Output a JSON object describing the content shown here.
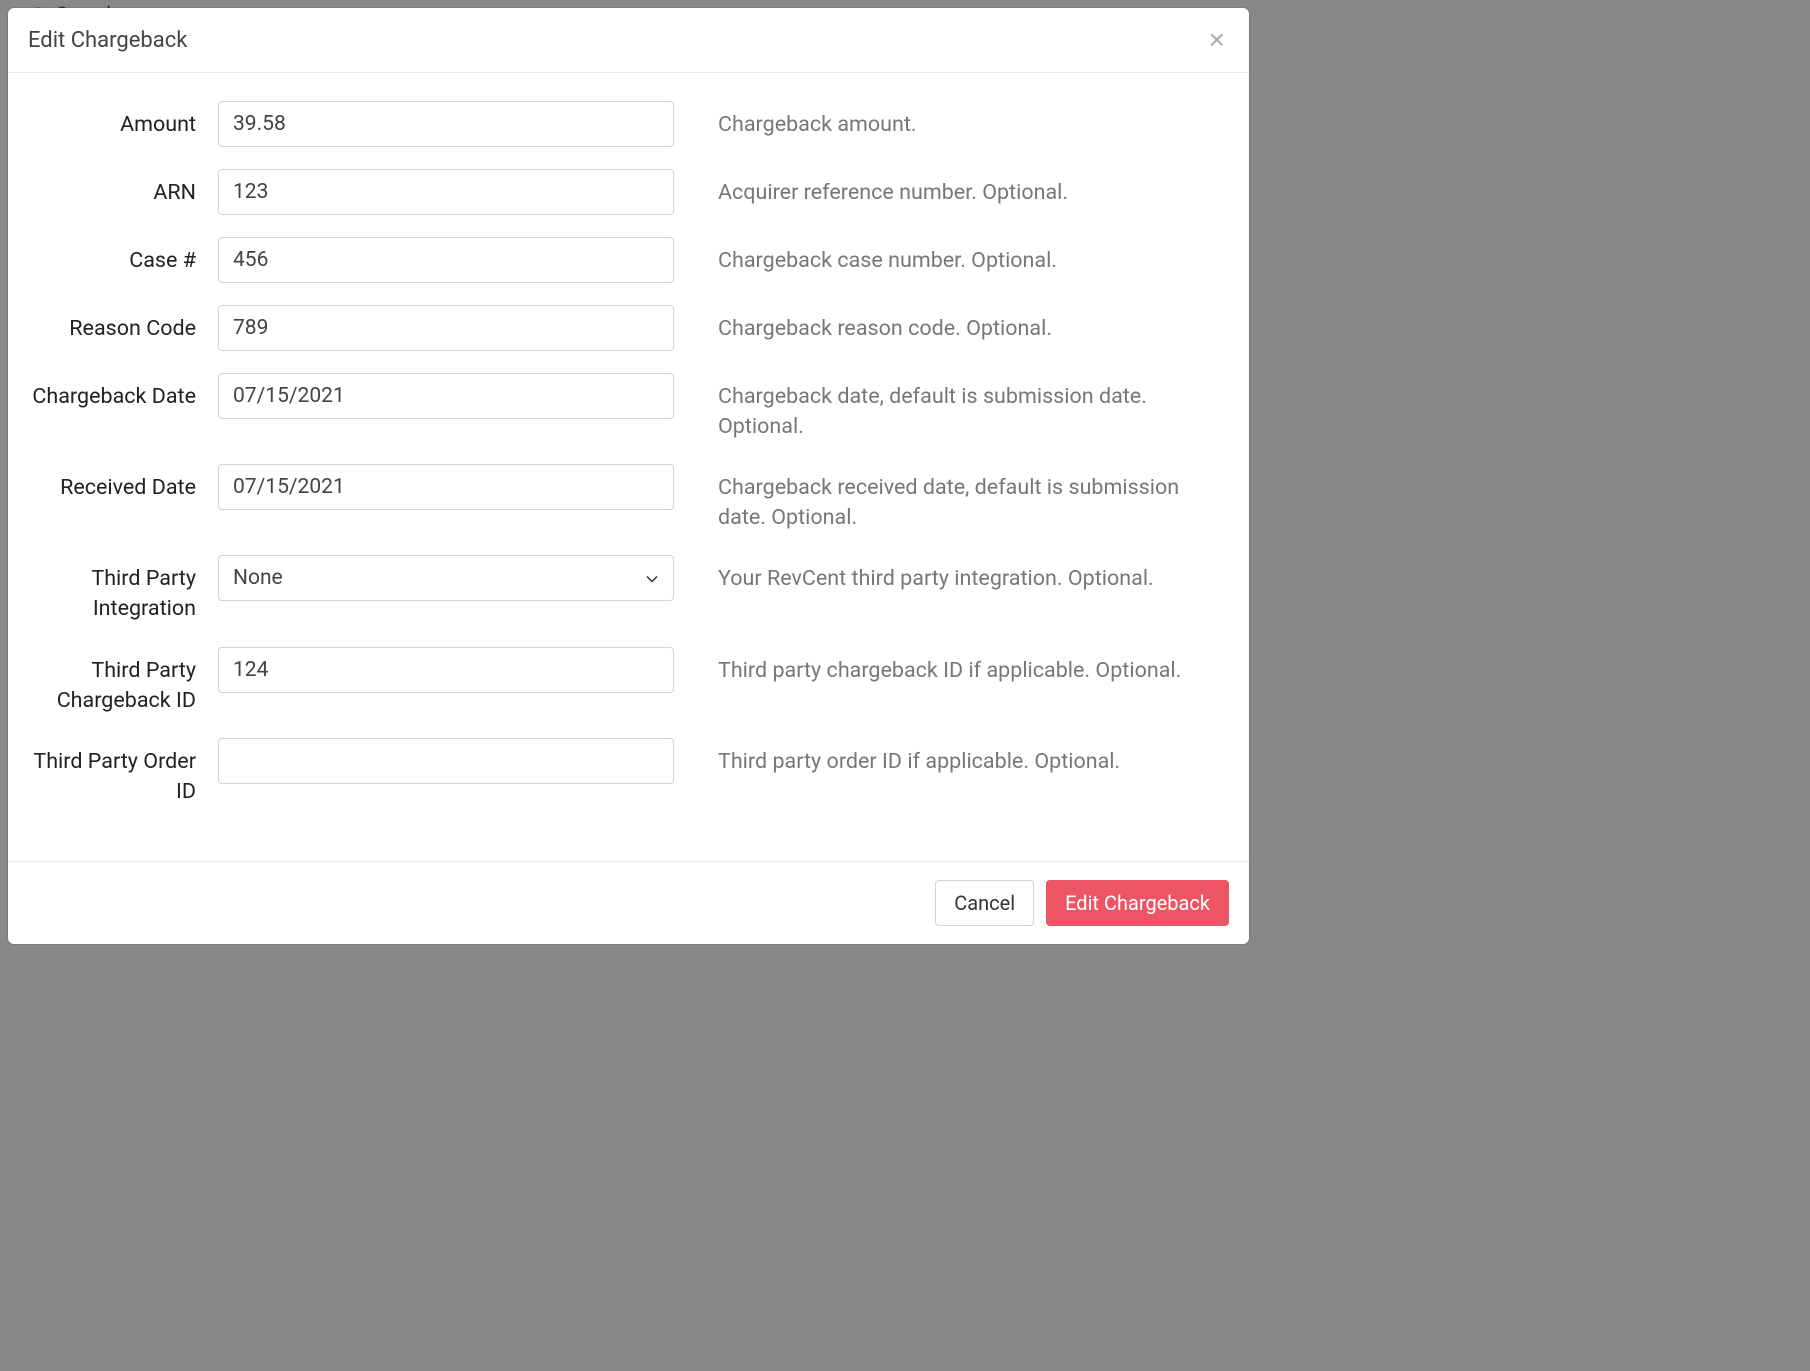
{
  "backdrop": {
    "search_hint": "Search"
  },
  "modal": {
    "title": "Edit Chargeback",
    "close_label": "×"
  },
  "form": {
    "amount": {
      "label": "Amount",
      "value": "39.58",
      "help": "Chargeback amount."
    },
    "arn": {
      "label": "ARN",
      "value": "123",
      "help": "Acquirer reference number. Optional."
    },
    "case_number": {
      "label": "Case #",
      "value": "456",
      "help": "Chargeback case number. Optional."
    },
    "reason_code": {
      "label": "Reason Code",
      "value": "789",
      "help": "Chargeback reason code. Optional."
    },
    "chargeback_date": {
      "label": "Chargeback Date",
      "value": "07/15/2021",
      "help": "Chargeback date, default is submission date. Optional."
    },
    "received_date": {
      "label": "Received Date",
      "value": "07/15/2021",
      "help": "Chargeback received date, default is submission date. Optional."
    },
    "third_party_integration": {
      "label": "Third Party Integration",
      "value": "None",
      "help": "Your RevCent third party integration. Optional."
    },
    "third_party_chargeback_id": {
      "label": "Third Party Chargeback ID",
      "value": "124",
      "help": "Third party chargeback ID if applicable. Optional."
    },
    "third_party_order_id": {
      "label": "Third Party Order ID",
      "value": "",
      "help": "Third party order ID if applicable. Optional."
    }
  },
  "footer": {
    "cancel_label": "Cancel",
    "submit_label": "Edit Chargeback"
  }
}
